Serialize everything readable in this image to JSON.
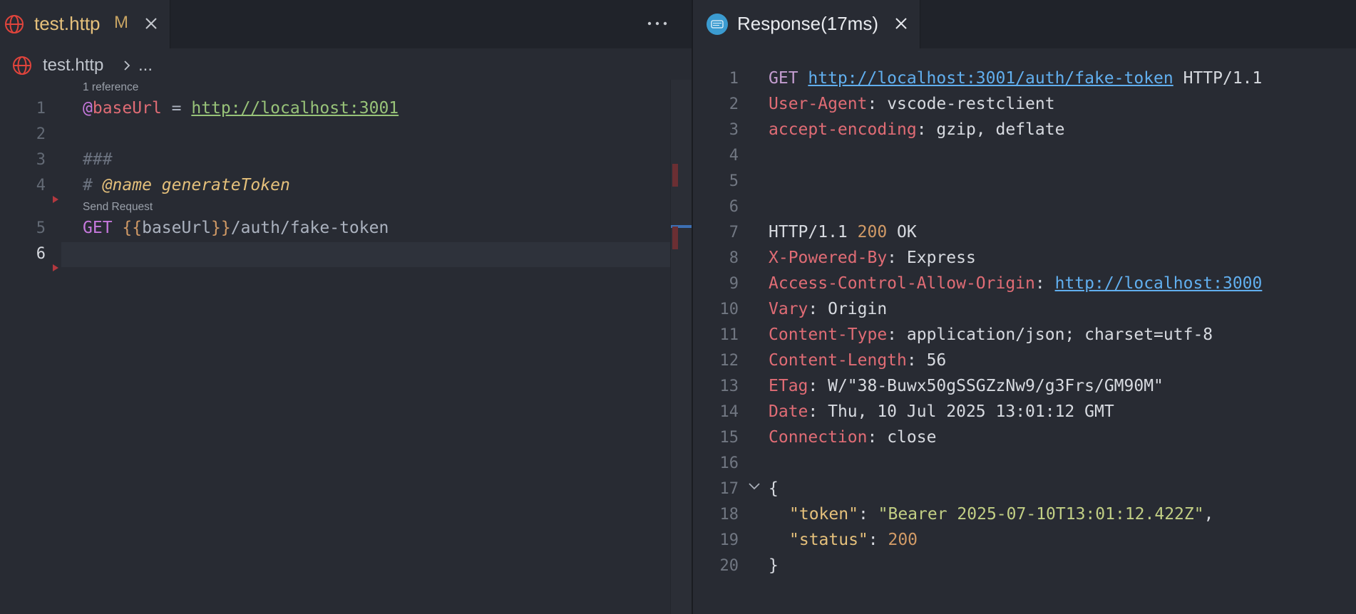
{
  "left_tab": {
    "title": "test.http",
    "modified": "M"
  },
  "breadcrumb": {
    "file": "test.http",
    "more": "..."
  },
  "editor": {
    "codelens_reference": "1 reference",
    "codelens_send": "Send Request",
    "lines": [
      {
        "num": "1",
        "at": "@",
        "var": "baseUrl",
        "op": " = ",
        "url": "http://localhost:3001"
      },
      {
        "num": "2"
      },
      {
        "num": "3",
        "comment": "###"
      },
      {
        "num": "4",
        "hash": "# ",
        "annot_tag": "@name",
        "annot_name": " generateToken"
      },
      {
        "num": "5",
        "method": "GET",
        "brace_open": "{{",
        "var": "baseUrl",
        "brace_close": "}}",
        "path": "/auth/fake-token"
      },
      {
        "num": "6"
      }
    ]
  },
  "right_tab": {
    "title": "Response(17ms)"
  },
  "response": {
    "request_line": {
      "method": "GET ",
      "url": "http://localhost:3001/auth/fake-token",
      "proto": " HTTP/1.1"
    },
    "request_headers": [
      {
        "name": "User-Agent",
        "sep": ": ",
        "value": "vscode-restclient"
      },
      {
        "name": "accept-encoding",
        "sep": ": ",
        "value": "gzip, deflate"
      }
    ],
    "status_line": {
      "proto": "HTTP/1.1 ",
      "code": "200",
      "text": " OK"
    },
    "response_headers": [
      {
        "name": "X-Powered-By",
        "sep": ": ",
        "value": "Express"
      },
      {
        "name": "Access-Control-Allow-Origin",
        "sep": ": ",
        "value": "http://localhost:3000"
      },
      {
        "name": "Vary",
        "sep": ": ",
        "value": "Origin"
      },
      {
        "name": "Content-Type",
        "sep": ": ",
        "value": "application/json; charset=utf-8"
      },
      {
        "name": "Content-Length",
        "sep": ": ",
        "value": "56"
      },
      {
        "name": "ETag",
        "sep": ": ",
        "value": "W/\"38-Buwx50gSSGZzNw9/g3Frs/GM90M\""
      },
      {
        "name": "Date",
        "sep": ": ",
        "value": "Thu, 10 Jul 2025 13:01:12 GMT"
      },
      {
        "name": "Connection",
        "sep": ": ",
        "value": "close"
      }
    ],
    "body": {
      "open": "{",
      "token_key": "\"token\"",
      "token_sep": ": ",
      "token_value": "\"Bearer 2025-07-10T13:01:12.422Z\"",
      "token_comma": ",",
      "status_key": "\"status\"",
      "status_sep": ": ",
      "status_value": "200",
      "close": "}"
    },
    "line_numbers": [
      "1",
      "2",
      "3",
      "4",
      "5",
      "6",
      "7",
      "8",
      "9",
      "10",
      "11",
      "12",
      "13",
      "14",
      "15",
      "16",
      "17",
      "18",
      "19",
      "20"
    ]
  },
  "colors": {
    "accent_red": "#e0443c",
    "keyword": "#c678dd",
    "string": "#98c379",
    "number": "#d19a66"
  }
}
